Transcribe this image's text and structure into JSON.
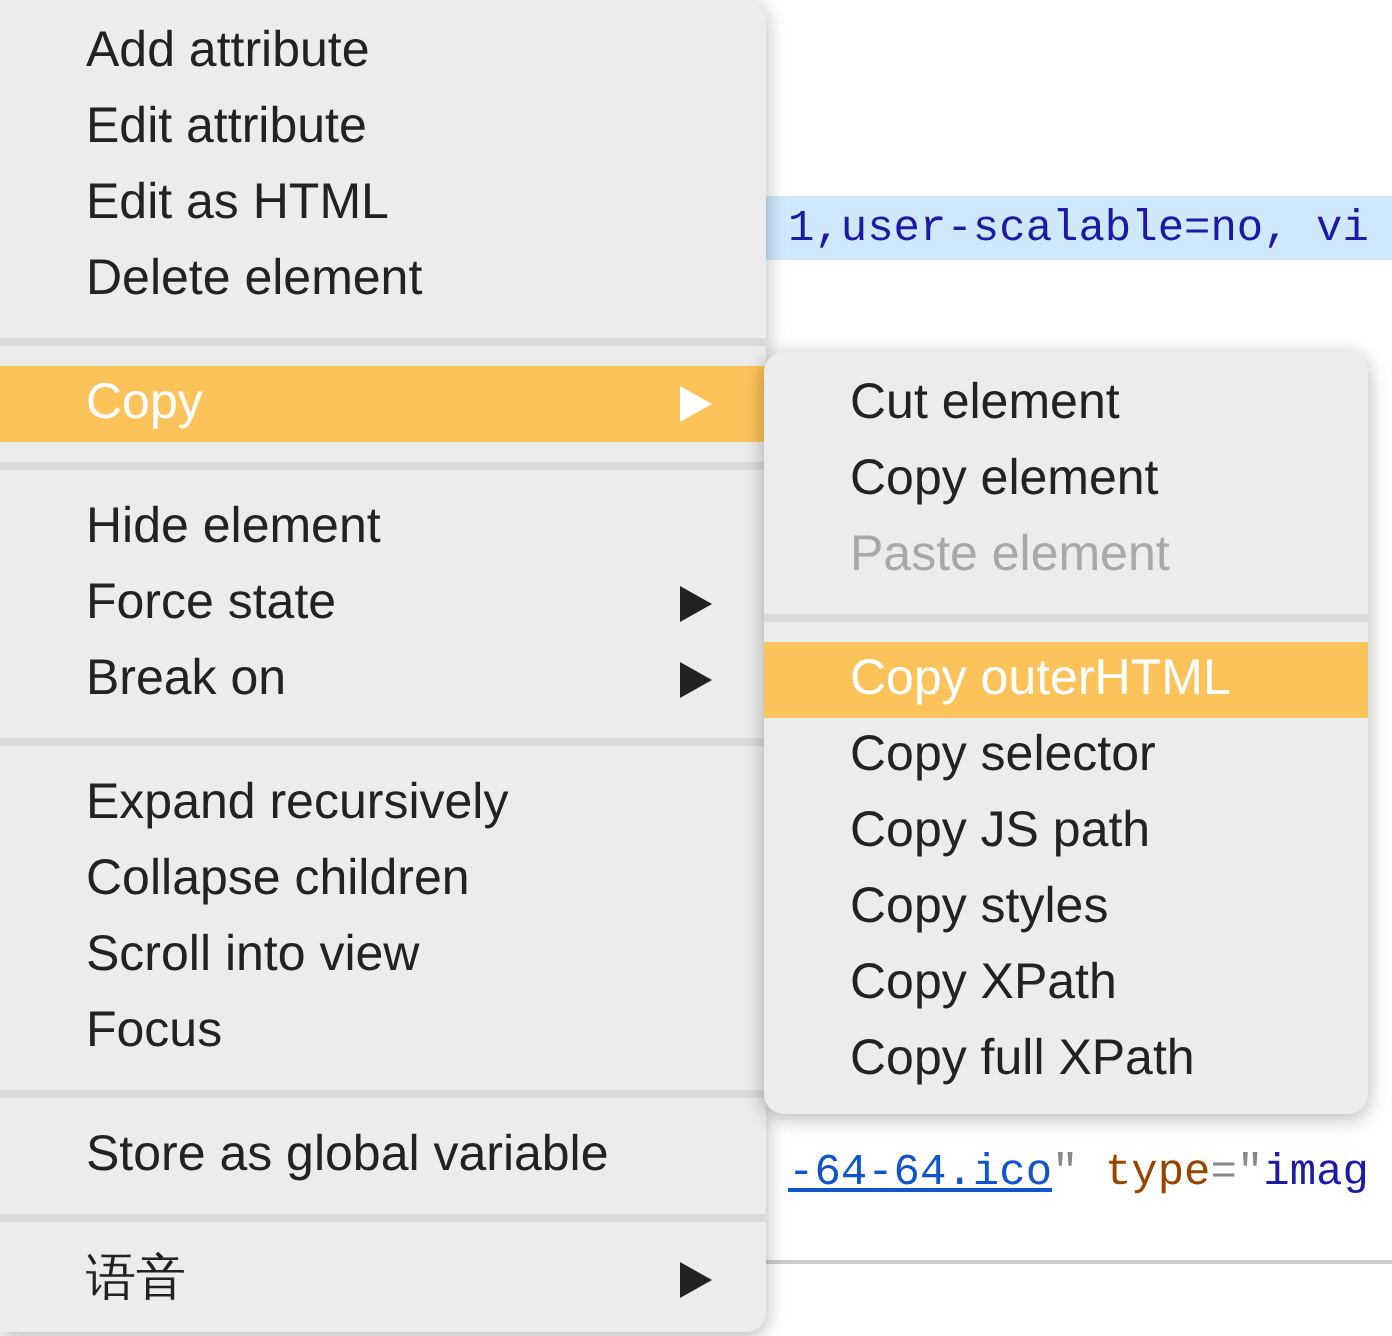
{
  "code_lines": [
    {
      "highlighted": true,
      "segments": [
        {
          "kind": "value",
          "text": "1,user-scalable=no, vi"
        }
      ]
    },
    {
      "highlighted": false,
      "segments": [
        {
          "kind": "link",
          "text": "-64-64.ico"
        },
        {
          "kind": "punct",
          "text": "\" "
        },
        {
          "kind": "attr",
          "text": "type"
        },
        {
          "kind": "punct",
          "text": "=\""
        },
        {
          "kind": "value",
          "text": "imag"
        }
      ]
    }
  ],
  "context_menu": {
    "groups": [
      [
        {
          "label": "Add attribute",
          "selected": false,
          "has_submenu": false
        },
        {
          "label": "Edit attribute",
          "selected": false,
          "has_submenu": false
        },
        {
          "label": "Edit as HTML",
          "selected": false,
          "has_submenu": false
        },
        {
          "label": "Delete element",
          "selected": false,
          "has_submenu": false
        }
      ],
      [
        {
          "label": "Copy",
          "selected": true,
          "has_submenu": true
        }
      ],
      [
        {
          "label": "Hide element",
          "selected": false,
          "has_submenu": false
        },
        {
          "label": "Force state",
          "selected": false,
          "has_submenu": true
        },
        {
          "label": "Break on",
          "selected": false,
          "has_submenu": true
        }
      ],
      [
        {
          "label": "Expand recursively",
          "selected": false,
          "has_submenu": false
        },
        {
          "label": "Collapse children",
          "selected": false,
          "has_submenu": false
        },
        {
          "label": "Scroll into view",
          "selected": false,
          "has_submenu": false
        },
        {
          "label": "Focus",
          "selected": false,
          "has_submenu": false
        }
      ],
      [
        {
          "label": "Store as global variable",
          "selected": false,
          "has_submenu": false
        }
      ],
      [
        {
          "label": "语音",
          "selected": false,
          "has_submenu": true
        }
      ]
    ]
  },
  "submenu": {
    "groups": [
      [
        {
          "label": "Cut element",
          "selected": false,
          "disabled": false
        },
        {
          "label": "Copy element",
          "selected": false,
          "disabled": false
        },
        {
          "label": "Paste element",
          "selected": false,
          "disabled": true
        }
      ],
      [
        {
          "label": "Copy outerHTML",
          "selected": true,
          "disabled": false
        },
        {
          "label": "Copy selector",
          "selected": false,
          "disabled": false
        },
        {
          "label": "Copy JS path",
          "selected": false,
          "disabled": false
        },
        {
          "label": "Copy styles",
          "selected": false,
          "disabled": false
        },
        {
          "label": "Copy XPath",
          "selected": false,
          "disabled": false
        },
        {
          "label": "Copy full XPath",
          "selected": false,
          "disabled": false
        }
      ]
    ]
  }
}
